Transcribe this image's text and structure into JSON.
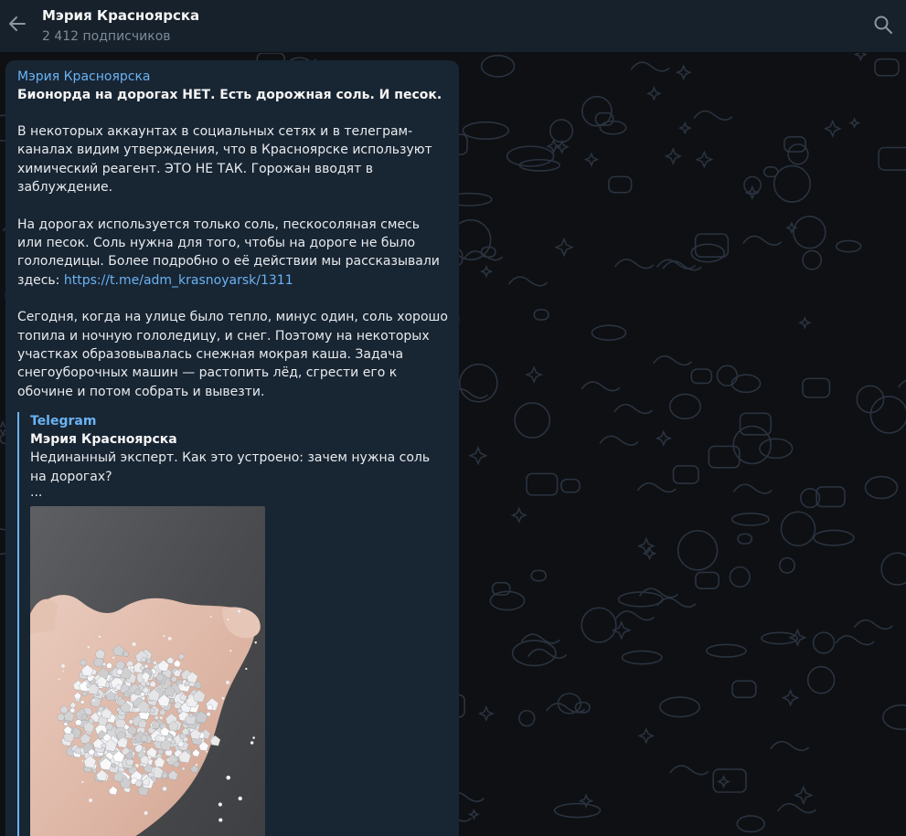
{
  "header": {
    "title": "Мэрия Красноярска",
    "subscribers": "2 412 подписчиков",
    "back_icon": "arrow-left-icon",
    "search_icon": "search-icon"
  },
  "message": {
    "author": "Мэрия Красноярска",
    "title": "Бионорда на дорогах НЕТ. Есть дорожная соль. И песок.",
    "p1": "В некоторых аккаунтах в социальных сетях и в телеграм-каналах видим утверждения, что в Красноярске используют химический реагент. ЭТО НЕ ТАК. Горожан вводят в заблуждение.",
    "p2": "На дорогах используется только соль, пескосоляная смесь или песок. Соль нужна для того, чтобы на дороге не было гололедицы. Более подробно о её действии мы рассказывали здесь: ",
    "p2_link": "https://t.me/adm_krasnoyarsk/1311",
    "p3": "Сегодня, когда на улице было тепло, минус один, соль хорошо топила и ночную гололедицу, и снег. Поэтому на некоторых участках образовывалась снежная мокрая каша. Задача снегоуборочных машин — растопить лёд, сгрести его к обочине и потом собрать и вывезти."
  },
  "quote": {
    "source": "Telegram",
    "author": "Мэрия Красноярска",
    "text": "Нединанный эксперт. Как это устроено: зачем нужна соль на дорогах?",
    "more": "..."
  },
  "colors": {
    "accent": "#6ab3f3",
    "header_bg": "#17212b",
    "bubble_bg": "#182533",
    "chat_bg": "#0e1013",
    "pattern": "#2a3340"
  }
}
